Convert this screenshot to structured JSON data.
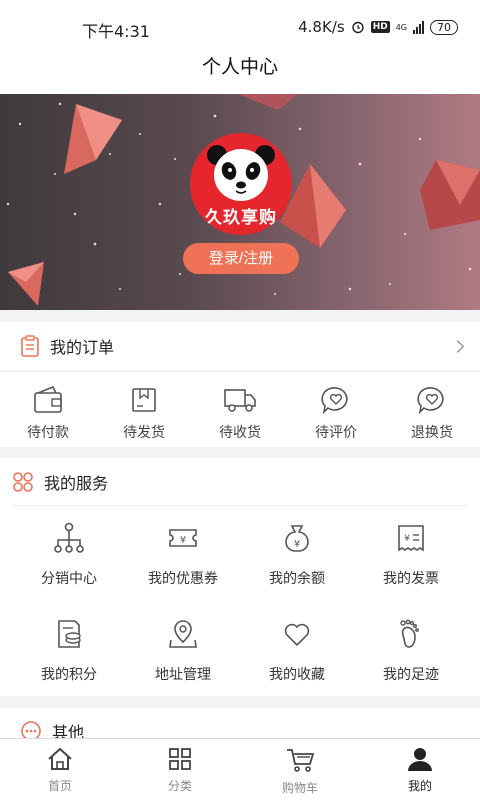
{
  "status_bar": {
    "time": "下午4:31",
    "speed": "4.8K/s",
    "hd": "HD",
    "net": "4G",
    "battery": "70"
  },
  "header": {
    "title": "个人中心"
  },
  "profile": {
    "avatar_text": "久玖享购",
    "login_label": "登录/注册"
  },
  "orders": {
    "title": "我的订单",
    "items": [
      {
        "label": "待付款",
        "icon": "wallet-icon"
      },
      {
        "label": "待发货",
        "icon": "box-icon"
      },
      {
        "label": "待收货",
        "icon": "truck-icon"
      },
      {
        "label": "待评价",
        "icon": "review-icon"
      },
      {
        "label": "退换货",
        "icon": "return-icon"
      }
    ]
  },
  "services": {
    "title": "我的服务",
    "items": [
      {
        "label": "分销中心",
        "icon": "network-icon"
      },
      {
        "label": "我的优惠券",
        "icon": "coupon-icon"
      },
      {
        "label": "我的余额",
        "icon": "money-bag-icon"
      },
      {
        "label": "我的发票",
        "icon": "invoice-icon"
      },
      {
        "label": "我的积分",
        "icon": "points-icon"
      },
      {
        "label": "地址管理",
        "icon": "location-icon"
      },
      {
        "label": "我的收藏",
        "icon": "heart-icon"
      },
      {
        "label": "我的足迹",
        "icon": "footprint-icon"
      }
    ]
  },
  "others": {
    "title": "其他"
  },
  "tabbar": {
    "items": [
      {
        "label": "首页",
        "icon": "home-icon"
      },
      {
        "label": "分类",
        "icon": "category-icon"
      },
      {
        "label": "购物车",
        "icon": "cart-icon"
      },
      {
        "label": "我的",
        "icon": "user-icon"
      }
    ]
  },
  "colors": {
    "accent": "#f07256",
    "brand_red": "#e5262c",
    "icon_gray": "#555555"
  }
}
